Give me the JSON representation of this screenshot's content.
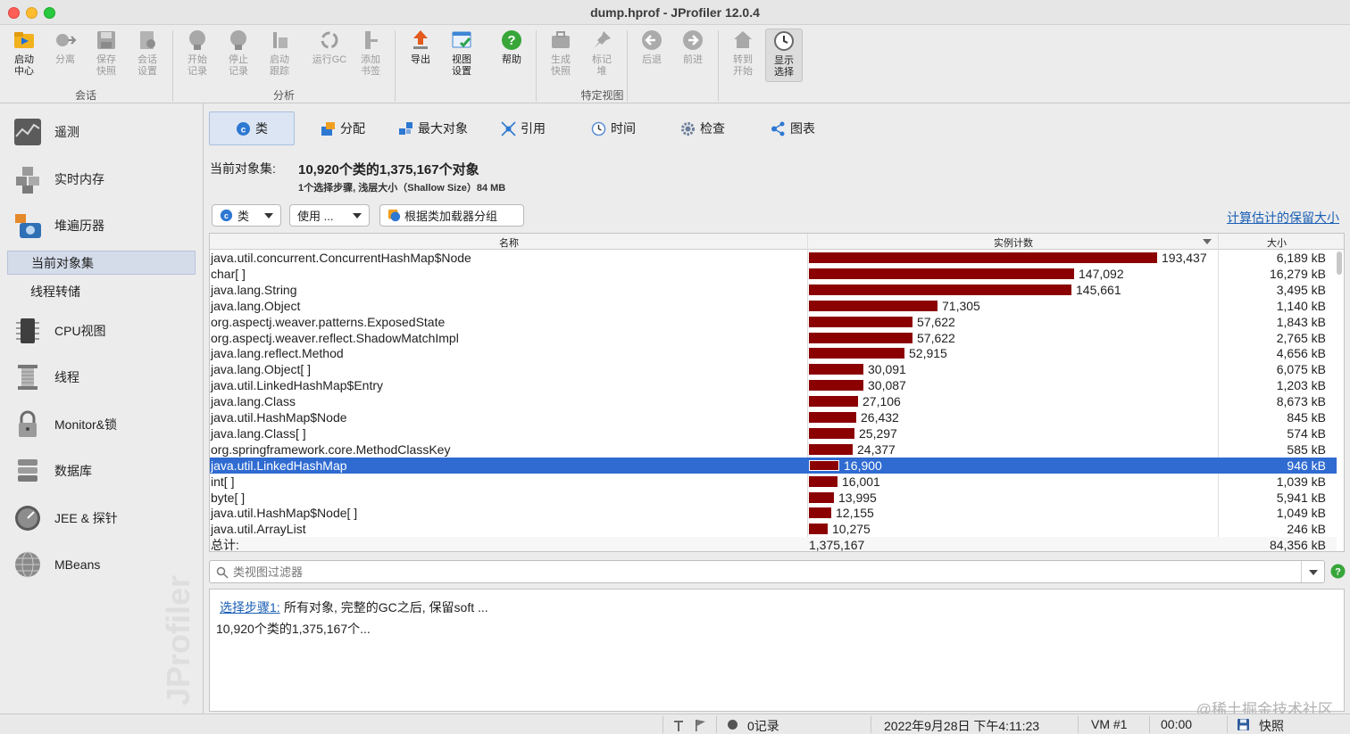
{
  "window": {
    "title": "dump.hprof - JProfiler 12.0.4"
  },
  "toolbar": {
    "groups": {
      "session": "会话",
      "analysis": "分析",
      "specific_views": "特定视图"
    },
    "buttons": {
      "start_center": [
        "启动",
        "中心"
      ],
      "detach": [
        "分离"
      ],
      "save_snapshot": [
        "保存",
        "快照"
      ],
      "session_settings": [
        "会话",
        "设置"
      ],
      "start_recording": [
        "开始",
        "记录"
      ],
      "stop_recording": [
        "停止",
        "记录"
      ],
      "start_tracking": [
        "启动",
        "跟踪"
      ],
      "run_gc": [
        "运行GC"
      ],
      "add_bookmark": [
        "添加",
        "书签"
      ],
      "export": [
        "导出"
      ],
      "view_settings": [
        "视图",
        "设置"
      ],
      "help": [
        "帮助"
      ],
      "create_snapshot": [
        "生成",
        "快照"
      ],
      "mark_heap": [
        "标记",
        "堆"
      ],
      "back": [
        "后退"
      ],
      "forward": [
        "前进"
      ],
      "go_to_start": [
        "转到",
        "开始"
      ],
      "show_selection": [
        "显示",
        "选择"
      ]
    }
  },
  "sidebar": {
    "items": {
      "telemetry": "遥测",
      "live_memory": "实时内存",
      "heap_walker": "堆遍历器",
      "current_objects": "当前对象集",
      "thread_dumps": "线程转储",
      "cpu_views": "CPU视图",
      "threads": "线程",
      "monitors": "Monitor&锁",
      "databases": "数据库",
      "jee": "JEE & 探针",
      "mbeans": "MBeans"
    },
    "watermark": "JProfiler"
  },
  "tabs": {
    "classes": "类",
    "allocations": "分配",
    "biggest_objects": "最大对象",
    "references": "引用",
    "time": "时间",
    "inspections": "检查",
    "graph": "图表"
  },
  "object_set": {
    "label": "当前对象集:",
    "summary": "10,920个类的1,375,167个对象",
    "details": "1个选择步骤, 浅层大小（Shallow Size）84 MB"
  },
  "controls": {
    "class_combo": "类",
    "use_combo": "使用 ...",
    "group_button": "根据类加载器分组",
    "calc_link": "计算估计的保留大小"
  },
  "table": {
    "headers": {
      "name": "名称",
      "count": "实例计数",
      "size": "大小"
    },
    "max_count": 193437,
    "rows": [
      {
        "name": "java.util.concurrent.ConcurrentHashMap$Node",
        "count": 193437,
        "count_label": "193,437",
        "size": "6,189 kB"
      },
      {
        "name": "char[ ]",
        "count": 147092,
        "count_label": "147,092",
        "size": "16,279 kB"
      },
      {
        "name": "java.lang.String",
        "count": 145661,
        "count_label": "145,661",
        "size": "3,495 kB"
      },
      {
        "name": "java.lang.Object",
        "count": 71305,
        "count_label": "71,305",
        "size": "1,140 kB"
      },
      {
        "name": "org.aspectj.weaver.patterns.ExposedState",
        "count": 57622,
        "count_label": "57,622",
        "size": "1,843 kB"
      },
      {
        "name": "org.aspectj.weaver.reflect.ShadowMatchImpl",
        "count": 57622,
        "count_label": "57,622",
        "size": "2,765 kB"
      },
      {
        "name": "java.lang.reflect.Method",
        "count": 52915,
        "count_label": "52,915",
        "size": "4,656 kB"
      },
      {
        "name": "java.lang.Object[ ]",
        "count": 30091,
        "count_label": "30,091",
        "size": "6,075 kB"
      },
      {
        "name": "java.util.LinkedHashMap$Entry",
        "count": 30087,
        "count_label": "30,087",
        "size": "1,203 kB"
      },
      {
        "name": "java.lang.Class",
        "count": 27106,
        "count_label": "27,106",
        "size": "8,673 kB"
      },
      {
        "name": "java.util.HashMap$Node",
        "count": 26432,
        "count_label": "26,432",
        "size": "845 kB"
      },
      {
        "name": "java.lang.Class[ ]",
        "count": 25297,
        "count_label": "25,297",
        "size": "574 kB"
      },
      {
        "name": "org.springframework.core.MethodClassKey",
        "count": 24377,
        "count_label": "24,377",
        "size": "585 kB"
      },
      {
        "name": "java.util.LinkedHashMap",
        "count": 16900,
        "count_label": "16,900",
        "size": "946 kB",
        "selected": true
      },
      {
        "name": "int[ ]",
        "count": 16001,
        "count_label": "16,001",
        "size": "1,039 kB"
      },
      {
        "name": "byte[ ]",
        "count": 13995,
        "count_label": "13,995",
        "size": "5,941 kB"
      },
      {
        "name": "java.util.HashMap$Node[ ]",
        "count": 12155,
        "count_label": "12,155",
        "size": "1,049 kB"
      },
      {
        "name": "java.util.ArrayList",
        "count": 10275,
        "count_label": "10,275",
        "size": "246 kB"
      }
    ],
    "total": {
      "label": "总计:",
      "count": "1,375,167",
      "size": "84,356 kB"
    }
  },
  "filter": {
    "placeholder": "类视图过滤器"
  },
  "selection_steps": {
    "link": "选择步骤1:",
    "description": "所有对象, 完整的GC之后, 保留soft ...",
    "line2": "10,920个类的1,375,167个..."
  },
  "corner_watermark": "@稀土掘金技术社区",
  "status_bar": {
    "records": "0记录",
    "datetime": "2022年9月28日 下午4:11:23",
    "vm": "VM #1",
    "elapsed": "00:00",
    "snapshot": "快照"
  },
  "colors": {
    "bar": "#8b0000",
    "selection": "#2f6bd1",
    "link": "#1a5fb4"
  }
}
